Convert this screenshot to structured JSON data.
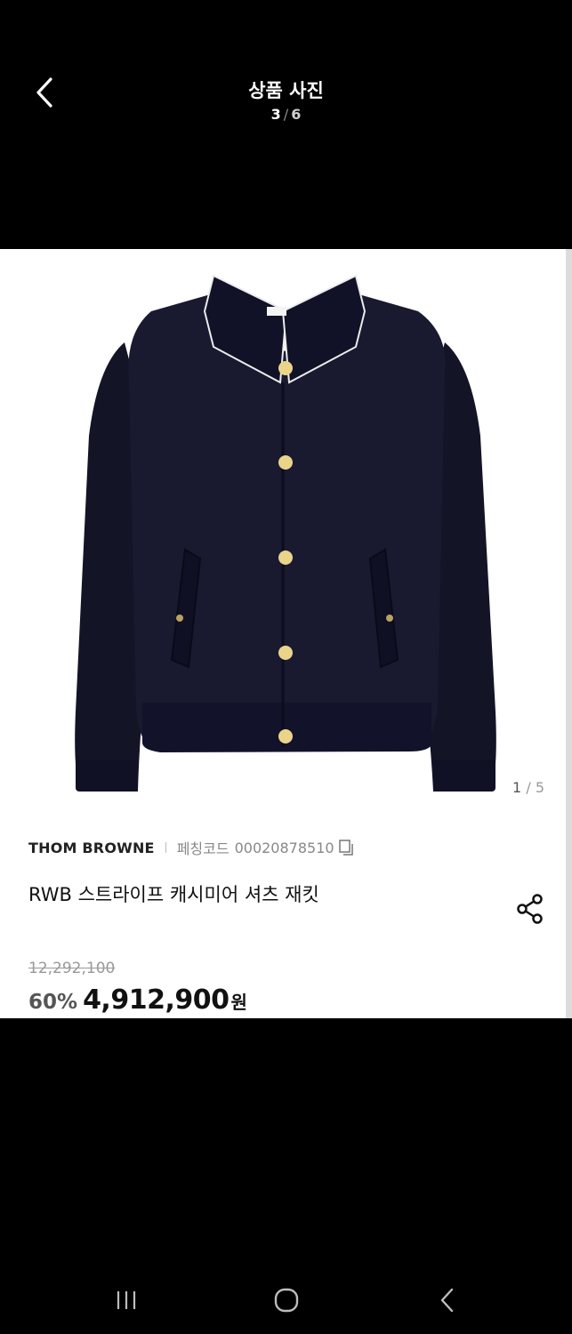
{
  "header": {
    "title": "상품 사진",
    "counter_current": "3",
    "counter_separator": "/",
    "counter_total": "6"
  },
  "product": {
    "image_counter_current": "1",
    "image_counter_separator": "/",
    "image_counter_total": "5",
    "brand": "THOM BROWNE",
    "code_label": "페칭코드",
    "code": "00020878510",
    "name": "RWB 스트라이프 캐시미어 셔츠 재킷",
    "original_price": "12,292,100",
    "discount": "60%",
    "price": "4,912,900",
    "currency": "원"
  },
  "icons": {
    "back": "chevron-left-icon",
    "copy": "copy-icon",
    "share": "share-icon",
    "nav_recents": "recent-apps-icon",
    "nav_home": "home-icon",
    "nav_back": "nav-back-icon"
  },
  "colors": {
    "background": "#000000",
    "card": "#ffffff",
    "jacket": "#151528",
    "buttons": "#e9d48a"
  }
}
